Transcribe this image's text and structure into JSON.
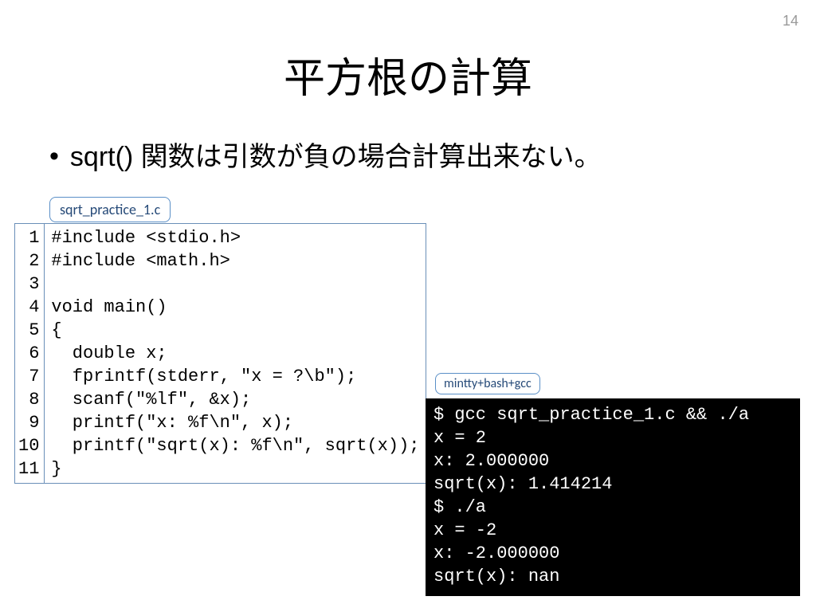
{
  "page_number": "14",
  "title": "平方根の計算",
  "bullet": "sqrt() 関数は引数が負の場合計算出来ない。",
  "source_file": {
    "label": "sqrt_practice_1.c",
    "lines": [
      "#include <stdio.h>",
      "#include <math.h>",
      "",
      "void main()",
      "{",
      "  double x;",
      "  fprintf(stderr, \"x = ?\\b\");",
      "  scanf(\"%lf\", &x);",
      "  printf(\"x: %f\\n\", x);",
      "  printf(\"sqrt(x): %f\\n\", sqrt(x));",
      "}"
    ],
    "line_numbers": [
      "1",
      "2",
      "3",
      "4",
      "5",
      "6",
      "7",
      "8",
      "9",
      "10",
      "11"
    ]
  },
  "terminal": {
    "label": "mintty+bash+gcc",
    "lines": [
      "$ gcc sqrt_practice_1.c && ./a",
      "x = 2",
      "x: 2.000000",
      "sqrt(x): 1.414214",
      "$ ./a",
      "x = -2",
      "x: -2.000000",
      "sqrt(x): nan"
    ]
  }
}
